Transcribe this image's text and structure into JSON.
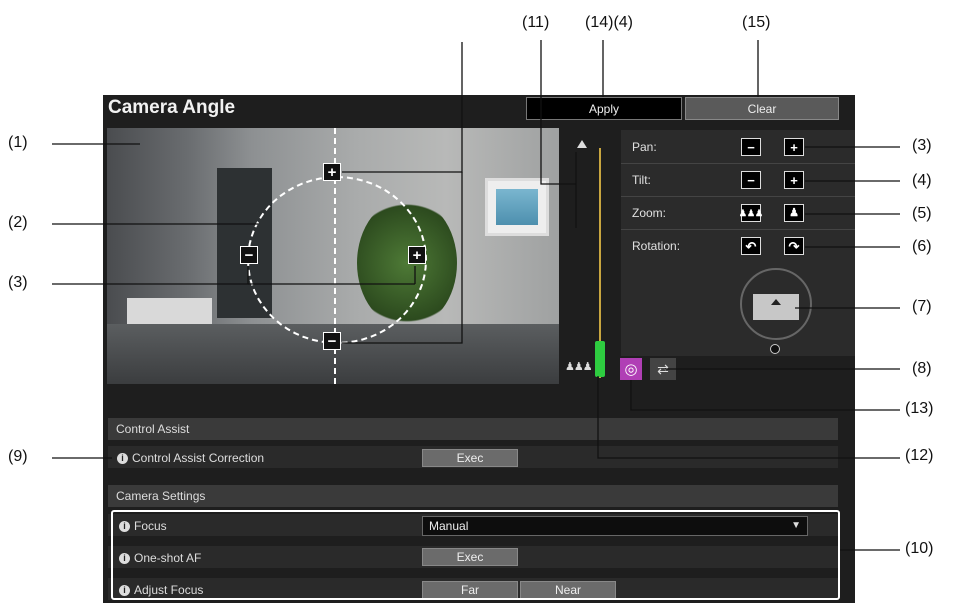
{
  "title": "Camera Angle",
  "buttons": {
    "apply": "Apply",
    "clear": "Clear"
  },
  "callouts": {
    "c1": "(1)",
    "c2": "(2)",
    "c3a": "(3)",
    "c3b": "(3)",
    "c4": "(4)",
    "c5": "(5)",
    "c6": "(6)",
    "c7": "(7)",
    "c8": "(8)",
    "c9": "(9)",
    "c10": "(10)",
    "c11": "(11)",
    "c12": "(12)",
    "c13": "(13)",
    "c14_4": "(14)(4)",
    "c15": "(15)"
  },
  "controls": {
    "pan": "Pan:",
    "tilt": "Tilt:",
    "zoom": "Zoom:",
    "rotation": "Rotation:"
  },
  "control_assist": {
    "header": "Control Assist",
    "correction_label": "Control Assist Correction",
    "exec": "Exec"
  },
  "camera_settings": {
    "header": "Camera Settings",
    "focus_label": "Focus",
    "focus_value": "Manual",
    "oneshot_label": "One-shot AF",
    "oneshot_exec": "Exec",
    "adjust_label": "Adjust Focus",
    "far": "Far",
    "near": "Near"
  },
  "icons": {
    "minus": "−",
    "plus": "+",
    "rotate_left": "↶",
    "rotate_right": "↷"
  }
}
